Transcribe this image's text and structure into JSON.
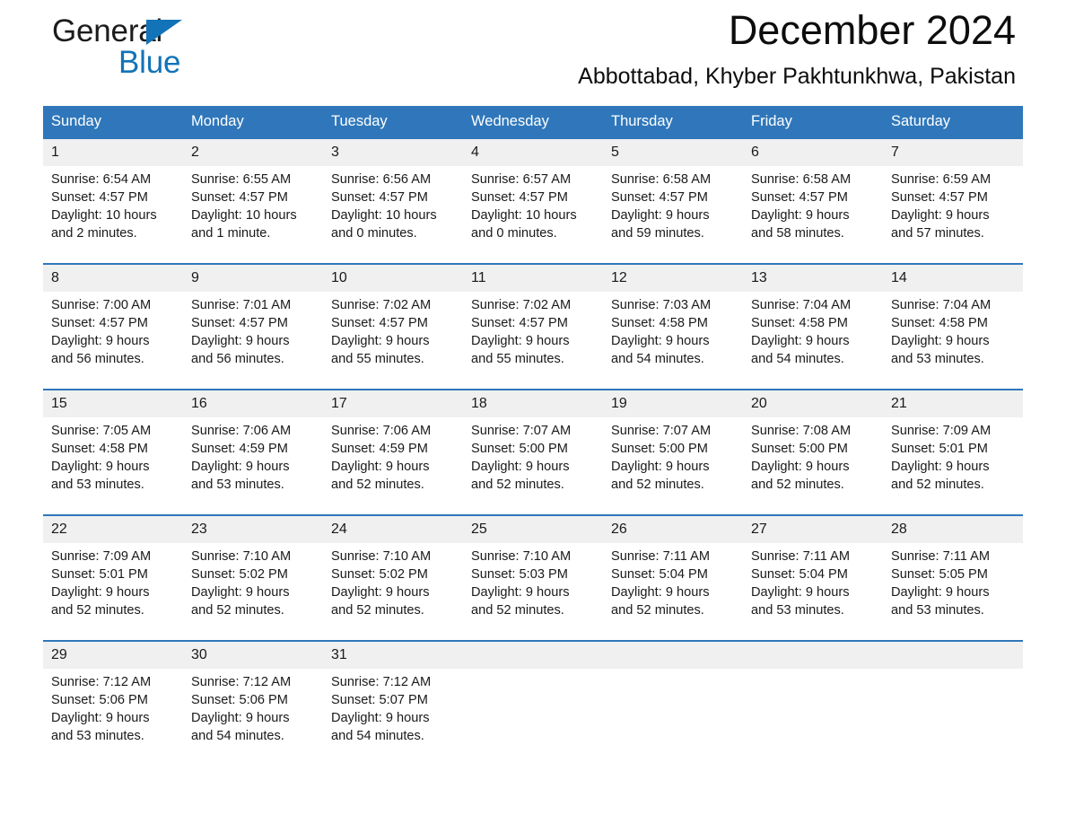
{
  "brand": {
    "name_part1": "General",
    "name_part2": "Blue",
    "triangle_color": "#1273b8"
  },
  "header": {
    "title": "December 2024",
    "subtitle": "Abbottabad, Khyber Pakhtunkhwa, Pakistan",
    "accent_color": "#2f77ba",
    "daynum_band_color": "#f0f0f0"
  },
  "weekdays": [
    "Sunday",
    "Monday",
    "Tuesday",
    "Wednesday",
    "Thursday",
    "Friday",
    "Saturday"
  ],
  "weeks": [
    {
      "days": [
        {
          "num": "1",
          "sunrise": "Sunrise: 6:54 AM",
          "sunset": "Sunset: 4:57 PM",
          "daylight_line1": "Daylight: 10 hours",
          "daylight_line2": "and 2 minutes."
        },
        {
          "num": "2",
          "sunrise": "Sunrise: 6:55 AM",
          "sunset": "Sunset: 4:57 PM",
          "daylight_line1": "Daylight: 10 hours",
          "daylight_line2": "and 1 minute."
        },
        {
          "num": "3",
          "sunrise": "Sunrise: 6:56 AM",
          "sunset": "Sunset: 4:57 PM",
          "daylight_line1": "Daylight: 10 hours",
          "daylight_line2": "and 0 minutes."
        },
        {
          "num": "4",
          "sunrise": "Sunrise: 6:57 AM",
          "sunset": "Sunset: 4:57 PM",
          "daylight_line1": "Daylight: 10 hours",
          "daylight_line2": "and 0 minutes."
        },
        {
          "num": "5",
          "sunrise": "Sunrise: 6:58 AM",
          "sunset": "Sunset: 4:57 PM",
          "daylight_line1": "Daylight: 9 hours",
          "daylight_line2": "and 59 minutes."
        },
        {
          "num": "6",
          "sunrise": "Sunrise: 6:58 AM",
          "sunset": "Sunset: 4:57 PM",
          "daylight_line1": "Daylight: 9 hours",
          "daylight_line2": "and 58 minutes."
        },
        {
          "num": "7",
          "sunrise": "Sunrise: 6:59 AM",
          "sunset": "Sunset: 4:57 PM",
          "daylight_line1": "Daylight: 9 hours",
          "daylight_line2": "and 57 minutes."
        }
      ]
    },
    {
      "days": [
        {
          "num": "8",
          "sunrise": "Sunrise: 7:00 AM",
          "sunset": "Sunset: 4:57 PM",
          "daylight_line1": "Daylight: 9 hours",
          "daylight_line2": "and 56 minutes."
        },
        {
          "num": "9",
          "sunrise": "Sunrise: 7:01 AM",
          "sunset": "Sunset: 4:57 PM",
          "daylight_line1": "Daylight: 9 hours",
          "daylight_line2": "and 56 minutes."
        },
        {
          "num": "10",
          "sunrise": "Sunrise: 7:02 AM",
          "sunset": "Sunset: 4:57 PM",
          "daylight_line1": "Daylight: 9 hours",
          "daylight_line2": "and 55 minutes."
        },
        {
          "num": "11",
          "sunrise": "Sunrise: 7:02 AM",
          "sunset": "Sunset: 4:57 PM",
          "daylight_line1": "Daylight: 9 hours",
          "daylight_line2": "and 55 minutes."
        },
        {
          "num": "12",
          "sunrise": "Sunrise: 7:03 AM",
          "sunset": "Sunset: 4:58 PM",
          "daylight_line1": "Daylight: 9 hours",
          "daylight_line2": "and 54 minutes."
        },
        {
          "num": "13",
          "sunrise": "Sunrise: 7:04 AM",
          "sunset": "Sunset: 4:58 PM",
          "daylight_line1": "Daylight: 9 hours",
          "daylight_line2": "and 54 minutes."
        },
        {
          "num": "14",
          "sunrise": "Sunrise: 7:04 AM",
          "sunset": "Sunset: 4:58 PM",
          "daylight_line1": "Daylight: 9 hours",
          "daylight_line2": "and 53 minutes."
        }
      ]
    },
    {
      "days": [
        {
          "num": "15",
          "sunrise": "Sunrise: 7:05 AM",
          "sunset": "Sunset: 4:58 PM",
          "daylight_line1": "Daylight: 9 hours",
          "daylight_line2": "and 53 minutes."
        },
        {
          "num": "16",
          "sunrise": "Sunrise: 7:06 AM",
          "sunset": "Sunset: 4:59 PM",
          "daylight_line1": "Daylight: 9 hours",
          "daylight_line2": "and 53 minutes."
        },
        {
          "num": "17",
          "sunrise": "Sunrise: 7:06 AM",
          "sunset": "Sunset: 4:59 PM",
          "daylight_line1": "Daylight: 9 hours",
          "daylight_line2": "and 52 minutes."
        },
        {
          "num": "18",
          "sunrise": "Sunrise: 7:07 AM",
          "sunset": "Sunset: 5:00 PM",
          "daylight_line1": "Daylight: 9 hours",
          "daylight_line2": "and 52 minutes."
        },
        {
          "num": "19",
          "sunrise": "Sunrise: 7:07 AM",
          "sunset": "Sunset: 5:00 PM",
          "daylight_line1": "Daylight: 9 hours",
          "daylight_line2": "and 52 minutes."
        },
        {
          "num": "20",
          "sunrise": "Sunrise: 7:08 AM",
          "sunset": "Sunset: 5:00 PM",
          "daylight_line1": "Daylight: 9 hours",
          "daylight_line2": "and 52 minutes."
        },
        {
          "num": "21",
          "sunrise": "Sunrise: 7:09 AM",
          "sunset": "Sunset: 5:01 PM",
          "daylight_line1": "Daylight: 9 hours",
          "daylight_line2": "and 52 minutes."
        }
      ]
    },
    {
      "days": [
        {
          "num": "22",
          "sunrise": "Sunrise: 7:09 AM",
          "sunset": "Sunset: 5:01 PM",
          "daylight_line1": "Daylight: 9 hours",
          "daylight_line2": "and 52 minutes."
        },
        {
          "num": "23",
          "sunrise": "Sunrise: 7:10 AM",
          "sunset": "Sunset: 5:02 PM",
          "daylight_line1": "Daylight: 9 hours",
          "daylight_line2": "and 52 minutes."
        },
        {
          "num": "24",
          "sunrise": "Sunrise: 7:10 AM",
          "sunset": "Sunset: 5:02 PM",
          "daylight_line1": "Daylight: 9 hours",
          "daylight_line2": "and 52 minutes."
        },
        {
          "num": "25",
          "sunrise": "Sunrise: 7:10 AM",
          "sunset": "Sunset: 5:03 PM",
          "daylight_line1": "Daylight: 9 hours",
          "daylight_line2": "and 52 minutes."
        },
        {
          "num": "26",
          "sunrise": "Sunrise: 7:11 AM",
          "sunset": "Sunset: 5:04 PM",
          "daylight_line1": "Daylight: 9 hours",
          "daylight_line2": "and 52 minutes."
        },
        {
          "num": "27",
          "sunrise": "Sunrise: 7:11 AM",
          "sunset": "Sunset: 5:04 PM",
          "daylight_line1": "Daylight: 9 hours",
          "daylight_line2": "and 53 minutes."
        },
        {
          "num": "28",
          "sunrise": "Sunrise: 7:11 AM",
          "sunset": "Sunset: 5:05 PM",
          "daylight_line1": "Daylight: 9 hours",
          "daylight_line2": "and 53 minutes."
        }
      ]
    },
    {
      "days": [
        {
          "num": "29",
          "sunrise": "Sunrise: 7:12 AM",
          "sunset": "Sunset: 5:06 PM",
          "daylight_line1": "Daylight: 9 hours",
          "daylight_line2": "and 53 minutes."
        },
        {
          "num": "30",
          "sunrise": "Sunrise: 7:12 AM",
          "sunset": "Sunset: 5:06 PM",
          "daylight_line1": "Daylight: 9 hours",
          "daylight_line2": "and 54 minutes."
        },
        {
          "num": "31",
          "sunrise": "Sunrise: 7:12 AM",
          "sunset": "Sunset: 5:07 PM",
          "daylight_line1": "Daylight: 9 hours",
          "daylight_line2": "and 54 minutes."
        },
        {
          "num": "",
          "sunrise": "",
          "sunset": "",
          "daylight_line1": "",
          "daylight_line2": ""
        },
        {
          "num": "",
          "sunrise": "",
          "sunset": "",
          "daylight_line1": "",
          "daylight_line2": ""
        },
        {
          "num": "",
          "sunrise": "",
          "sunset": "",
          "daylight_line1": "",
          "daylight_line2": ""
        },
        {
          "num": "",
          "sunrise": "",
          "sunset": "",
          "daylight_line1": "",
          "daylight_line2": ""
        }
      ]
    }
  ]
}
